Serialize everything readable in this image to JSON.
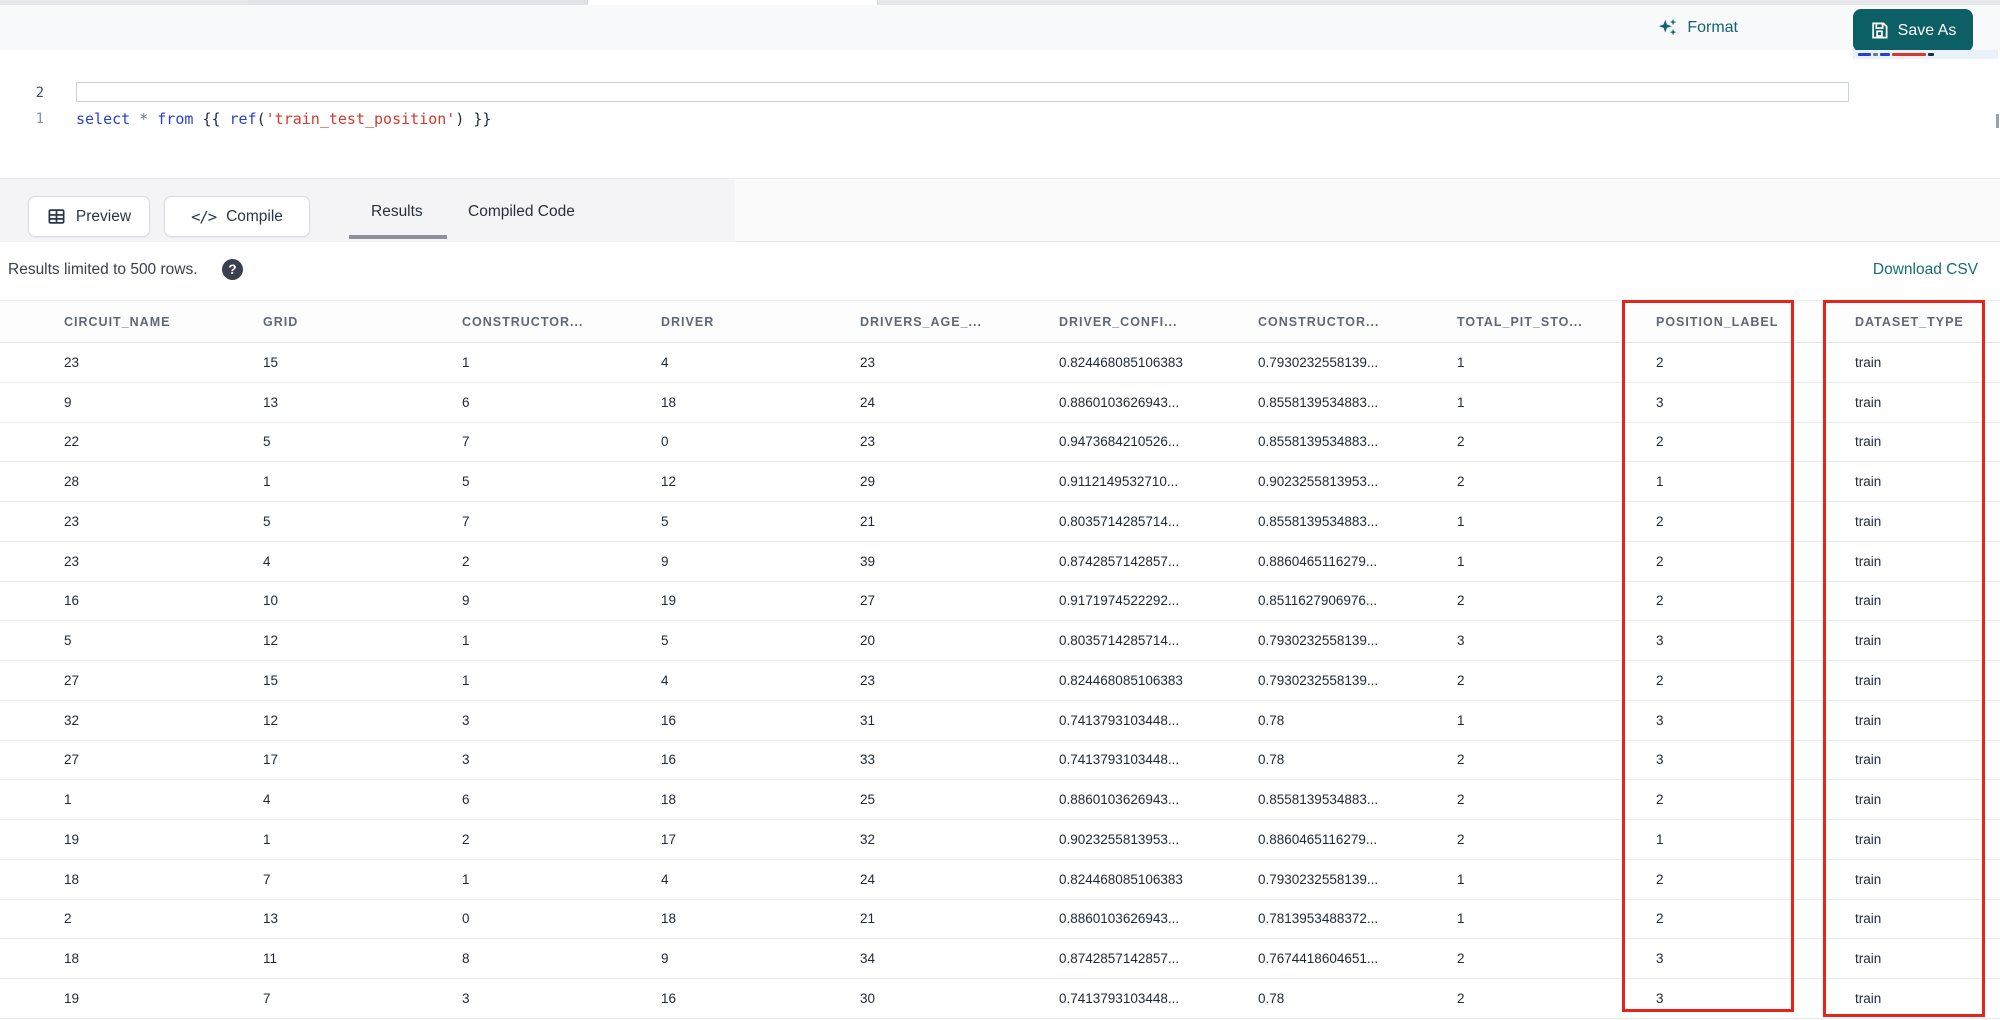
{
  "topbar": {
    "format_label": "Format",
    "save_as_label": "Save As"
  },
  "editor": {
    "line1_number": "1",
    "line2_number": "2",
    "code_plain": "select * from {{ ref('train_test_position') }}",
    "tokens": [
      {
        "t": "select",
        "c": "kw"
      },
      {
        "t": " ",
        "c": "br"
      },
      {
        "t": "*",
        "c": "op"
      },
      {
        "t": " ",
        "c": "br"
      },
      {
        "t": "from",
        "c": "kw"
      },
      {
        "t": " ",
        "c": "br"
      },
      {
        "t": "{{ ",
        "c": "br"
      },
      {
        "t": "ref",
        "c": "fn"
      },
      {
        "t": "(",
        "c": "br"
      },
      {
        "t": "'train_test_position'",
        "c": "str"
      },
      {
        "t": ") ",
        "c": "br"
      },
      {
        "t": "}}",
        "c": "br"
      }
    ]
  },
  "toolbar": {
    "preview_label": "Preview",
    "compile_label": "Compile",
    "compile_glyph": "</>",
    "tabs": [
      {
        "label": "Results",
        "active": true
      },
      {
        "label": "Compiled Code",
        "active": false
      }
    ]
  },
  "results_bar": {
    "note": "Results limited to 500 rows.",
    "help_glyph": "?",
    "download_label": "Download CSV"
  },
  "table": {
    "headers": [
      "CIRCUIT_NAME",
      "GRID",
      "CONSTRUCTOR...",
      "DRIVER",
      "DRIVERS_AGE_...",
      "DRIVER_CONFI...",
      "CONSTRUCTOR...",
      "TOTAL_PIT_STO...",
      "POSITION_LABEL",
      "DATASET_TYPE"
    ],
    "highlighted_columns": [
      "POSITION_LABEL",
      "DATASET_TYPE"
    ],
    "rows": [
      [
        "23",
        "15",
        "1",
        "4",
        "23",
        "0.824468085106383",
        "0.7930232558139...",
        "1",
        "2",
        "train"
      ],
      [
        "9",
        "13",
        "6",
        "18",
        "24",
        "0.8860103626943...",
        "0.8558139534883...",
        "1",
        "3",
        "train"
      ],
      [
        "22",
        "5",
        "7",
        "0",
        "23",
        "0.9473684210526...",
        "0.8558139534883...",
        "2",
        "2",
        "train"
      ],
      [
        "28",
        "1",
        "5",
        "12",
        "29",
        "0.9112149532710...",
        "0.9023255813953...",
        "2",
        "1",
        "train"
      ],
      [
        "23",
        "5",
        "7",
        "5",
        "21",
        "0.8035714285714...",
        "0.8558139534883...",
        "1",
        "2",
        "train"
      ],
      [
        "23",
        "4",
        "2",
        "9",
        "39",
        "0.8742857142857...",
        "0.8860465116279...",
        "1",
        "2",
        "train"
      ],
      [
        "16",
        "10",
        "9",
        "19",
        "27",
        "0.9171974522292...",
        "0.8511627906976...",
        "2",
        "2",
        "train"
      ],
      [
        "5",
        "12",
        "1",
        "5",
        "20",
        "0.8035714285714...",
        "0.7930232558139...",
        "3",
        "3",
        "train"
      ],
      [
        "27",
        "15",
        "1",
        "4",
        "23",
        "0.824468085106383",
        "0.7930232558139...",
        "2",
        "2",
        "train"
      ],
      [
        "32",
        "12",
        "3",
        "16",
        "31",
        "0.7413793103448...",
        "0.78",
        "1",
        "3",
        "train"
      ],
      [
        "27",
        "17",
        "3",
        "16",
        "33",
        "0.7413793103448...",
        "0.78",
        "2",
        "3",
        "train"
      ],
      [
        "1",
        "4",
        "6",
        "18",
        "25",
        "0.8860103626943...",
        "0.8558139534883...",
        "2",
        "2",
        "train"
      ],
      [
        "19",
        "1",
        "2",
        "17",
        "32",
        "0.9023255813953...",
        "0.8860465116279...",
        "2",
        "1",
        "train"
      ],
      [
        "18",
        "7",
        "1",
        "4",
        "24",
        "0.824468085106383",
        "0.7930232558139...",
        "1",
        "2",
        "train"
      ],
      [
        "2",
        "13",
        "0",
        "18",
        "21",
        "0.8860103626943...",
        "0.7813953488372...",
        "1",
        "2",
        "train"
      ],
      [
        "18",
        "11",
        "8",
        "9",
        "34",
        "0.8742857142857...",
        "0.7674418604651...",
        "2",
        "3",
        "train"
      ],
      [
        "19",
        "7",
        "3",
        "16",
        "30",
        "0.7413793103448...",
        "0.78",
        "2",
        "3",
        "train"
      ]
    ]
  },
  "colors": {
    "accent_teal": "#0d5f66",
    "link_teal": "#176d77",
    "highlight_red": "#e8231a",
    "keyword_blue": "#2a3fd0",
    "string_red": "#d8382c"
  }
}
